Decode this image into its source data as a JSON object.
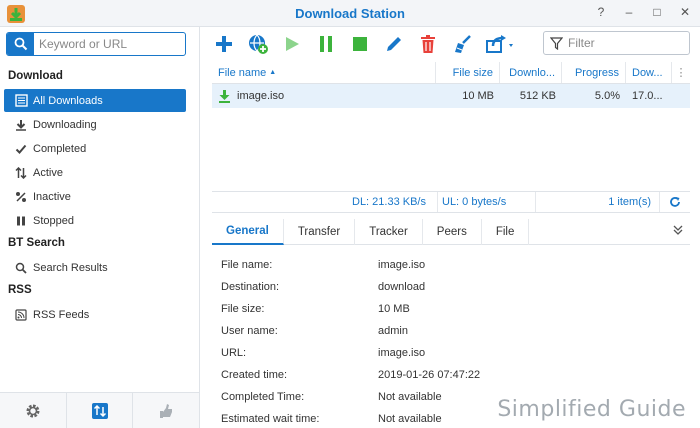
{
  "window": {
    "title": "Download Station",
    "controls": [
      "?",
      "–",
      "□",
      "✕"
    ]
  },
  "sidebar": {
    "search_placeholder": "Keyword or URL",
    "sections": {
      "download": "Download",
      "bt_search": "BT Search",
      "rss": "RSS"
    },
    "items": [
      {
        "label": "All Downloads",
        "icon": "all-downloads-icon",
        "active": true
      },
      {
        "label": "Downloading",
        "icon": "downloading-icon"
      },
      {
        "label": "Completed",
        "icon": "completed-icon"
      },
      {
        "label": "Active",
        "icon": "active-icon"
      },
      {
        "label": "Inactive",
        "icon": "inactive-icon"
      },
      {
        "label": "Stopped",
        "icon": "stopped-icon"
      },
      {
        "label": "Search Results",
        "icon": "search-results-icon"
      },
      {
        "label": "RSS Feeds",
        "icon": "rss-feeds-icon"
      }
    ],
    "footer": [
      "settings-icon",
      "sort-icon",
      "hand-icon"
    ]
  },
  "toolbar": {
    "buttons": [
      "add-icon",
      "add-url-icon",
      "resume-icon",
      "pause-icon",
      "stop-icon",
      "edit-icon",
      "delete-icon",
      "clean-up-icon",
      "share-icon"
    ],
    "filter_placeholder": "Filter"
  },
  "grid": {
    "columns": [
      "File name",
      "File size",
      "Downlo...",
      "Progress",
      "Dow..."
    ],
    "rows": [
      {
        "file_name": "image.iso",
        "file_size": "10 MB",
        "downloaded": "512 KB",
        "progress": "5.0%",
        "speed": "17.0..."
      }
    ]
  },
  "status": {
    "dl": "DL: 21.33 KB/s",
    "ul": "UL: 0 bytes/s",
    "count": "1 item(s)"
  },
  "tabs": [
    "General",
    "Transfer",
    "Tracker",
    "Peers",
    "File"
  ],
  "details": [
    {
      "label": "File name:",
      "value": "image.iso"
    },
    {
      "label": "Destination:",
      "value": "download"
    },
    {
      "label": "File size:",
      "value": "10 MB"
    },
    {
      "label": "User name:",
      "value": "admin"
    },
    {
      "label": "URL:",
      "value": "image.iso"
    },
    {
      "label": "Created time:",
      "value": "2019-01-26 07:47:22"
    },
    {
      "label": "Completed Time:",
      "value": "Not available"
    },
    {
      "label": "Estimated wait time:",
      "value": "Not available"
    }
  ],
  "watermark": "Simplified Guide",
  "colors": {
    "accent": "#1877c9",
    "green": "#3cb33c",
    "red": "#e8413a"
  }
}
